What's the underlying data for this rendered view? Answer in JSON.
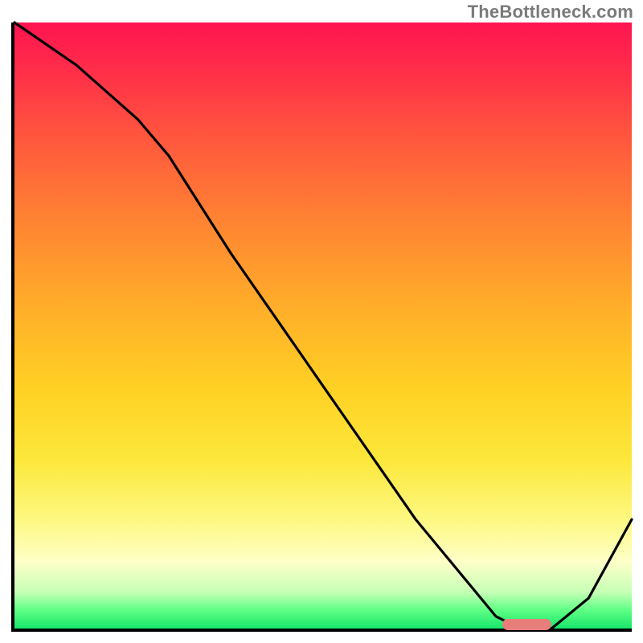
{
  "watermark": "TheBottleneck.com",
  "colors": {
    "axis": "#000000",
    "curve": "#000000",
    "marker": "#e77e7b",
    "gradient_top": "#ff1450",
    "gradient_bottom": "#17e66a"
  },
  "chart_data": {
    "type": "line",
    "title": "",
    "xlabel": "",
    "ylabel": "",
    "xlim": [
      0,
      100
    ],
    "ylim": [
      0,
      100
    ],
    "grid": false,
    "legend": false,
    "x": [
      0,
      10,
      20,
      25,
      35,
      50,
      65,
      78,
      82,
      87,
      93,
      100
    ],
    "values": [
      100,
      93,
      84,
      78,
      62,
      40,
      18,
      2,
      0,
      0,
      5,
      18
    ],
    "annotations": [
      {
        "kind": "marker-pill",
        "x_start": 79,
        "x_end": 87,
        "y": 0
      }
    ],
    "notes": "Background is a vertical heat gradient (red→orange→yellow→green). Single black curve descends from top-left, steepens after x≈25, reaches a minimum plateau at y≈0 around x≈80–87, then rises toward the right edge. A small pink rounded pill marks the minimum region on the x-axis."
  }
}
